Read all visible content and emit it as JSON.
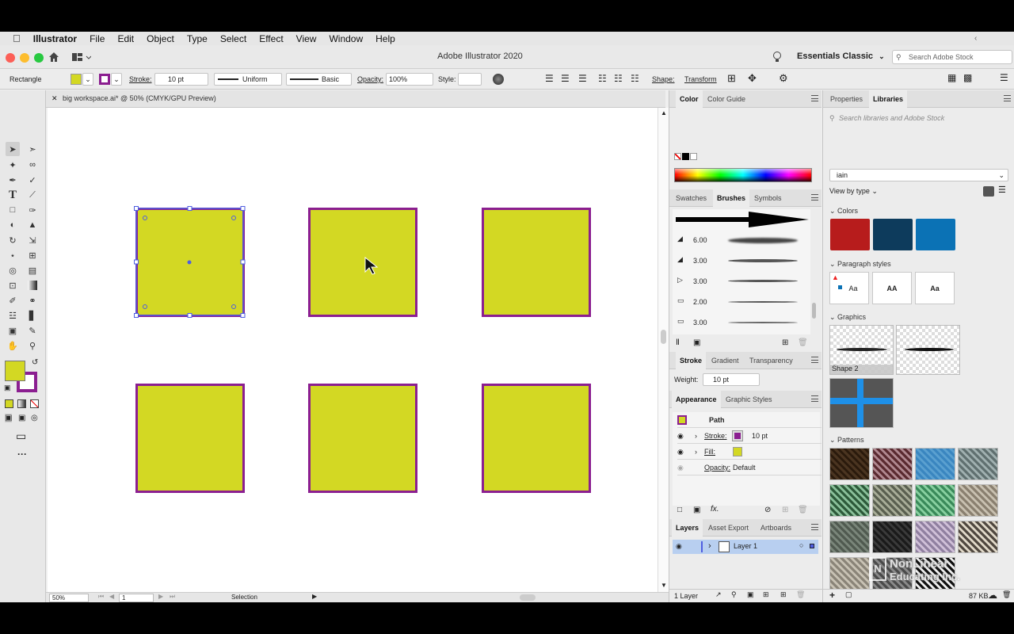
{
  "menubar": {
    "app_name": "Illustrator",
    "items": [
      "File",
      "Edit",
      "Object",
      "Type",
      "Select",
      "Effect",
      "View",
      "Window",
      "Help"
    ]
  },
  "titlebar": {
    "title": "Adobe Illustrator 2020",
    "workspace": "Essentials Classic",
    "search_placeholder": "Search Adobe Stock"
  },
  "control": {
    "selection_type": "Rectangle",
    "stroke_label": "Stroke:",
    "stroke_weight": "10 pt",
    "profile": "Uniform",
    "brush": "Basic",
    "opacity_label": "Opacity:",
    "opacity_value": "100%",
    "style_label": "Style:",
    "shape_label": "Shape:",
    "transform_label": "Transform",
    "fill_color": "#d3d823",
    "stroke_color": "#8b1e90"
  },
  "document": {
    "tab_title": "big workspace.ai* @ 50% (CMYK/GPU Preview)",
    "zoom": "50%",
    "artboard": "1",
    "status": "Selection"
  },
  "color_panel": {
    "tabs": [
      "Color",
      "Color Guide"
    ]
  },
  "brushes_panel": {
    "tabs": [
      "Swatches",
      "Brushes",
      "Symbols"
    ],
    "sizes": [
      "6.00",
      "3.00",
      "3.00",
      "2.00",
      "3.00"
    ]
  },
  "stroke_panel": {
    "tabs": [
      "Stroke",
      "Gradient",
      "Transparency"
    ],
    "weight_label": "Weight:",
    "weight_value": "10 pt"
  },
  "appearance_panel": {
    "tabs": [
      "Appearance",
      "Graphic Styles"
    ],
    "object": "Path",
    "stroke_label": "Stroke:",
    "stroke_value": "10 pt",
    "fill_label": "Fill:",
    "opacity_label": "Opacity:",
    "opacity_value": "Default"
  },
  "layers_panel": {
    "tabs": [
      "Layers",
      "Asset Export",
      "Artboards"
    ],
    "layer_name": "Layer 1",
    "count": "1 Layer"
  },
  "libraries_panel": {
    "tabs": [
      "Properties",
      "Libraries"
    ],
    "search_placeholder": "Search libraries and Adobe Stock",
    "library": "iain",
    "view_by": "View by type",
    "colors_title": "Colors",
    "colors": [
      "#b71c1c",
      "#0d3b5c",
      "#0b72b5"
    ],
    "paragraph_title": "Paragraph styles",
    "para_samples": [
      "Aa",
      "AA",
      "Aa"
    ],
    "graphics_title": "Graphics",
    "graphic_label": "Shape 2",
    "patterns_title": "Patterns",
    "size": "87 KB"
  },
  "watermark": {
    "line1": "NonLinear",
    "line2": "Educating Inc."
  }
}
